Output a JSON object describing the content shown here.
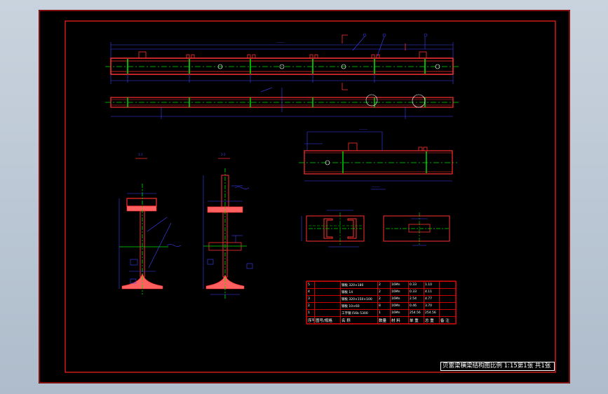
{
  "title_block": {
    "text": "贝雷梁横梁结构图比例 1:15第1张 共1张"
  },
  "bom": {
    "header": [
      "序号",
      "图号/规格",
      "名 称",
      "数量",
      "材 料",
      "单 重",
      "总 重",
      "备 注"
    ],
    "rows": [
      [
        "5",
        "",
        "钢板 320×180",
        "2",
        "16Mn",
        "0.33",
        "1.10",
        ""
      ],
      [
        "4",
        "",
        "钢板 14",
        "2",
        "16Mn",
        "0.33",
        "4.11",
        ""
      ],
      [
        "3",
        "",
        "钢板 320×150×100",
        "2",
        "16Mn",
        "2.54",
        "4.77",
        ""
      ],
      [
        "2",
        "",
        "钢板 10×60",
        "8",
        "16Mn",
        "0.46",
        "3.70",
        ""
      ],
      [
        "1",
        "",
        "工字钢 I56b 5300",
        "1",
        "16Mn",
        "254.56",
        "254.56",
        ""
      ]
    ]
  },
  "colors": {
    "frame": "#ff2020",
    "outline": "#ff3030",
    "centerline": "#00e000",
    "dimension": "#4040ff",
    "text": "#ffffff",
    "hatch": "#ff6060"
  }
}
